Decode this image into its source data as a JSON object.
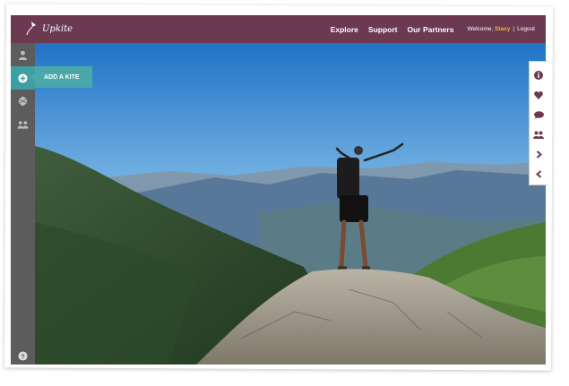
{
  "brand": {
    "logo_text": "Upkite"
  },
  "nav": {
    "links": [
      "Explore",
      "Support",
      "Our Partners"
    ],
    "welcome_prefix": "Welcome,",
    "username": "Stacy",
    "separator": "|",
    "logout": "Logout"
  },
  "sidebar": {
    "items": [
      {
        "icon": "user-icon"
      },
      {
        "icon": "plus-circle-icon",
        "active": true
      },
      {
        "icon": "kite-icon"
      },
      {
        "icon": "group-icon"
      }
    ],
    "help_icon": "help-icon"
  },
  "add_kite": {
    "label": "ADD A KITE"
  },
  "rightbar": {
    "icons": [
      "info-icon",
      "heart-icon",
      "comment-icon",
      "people-icon",
      "chevron-right-icon",
      "chevron-left-icon"
    ]
  },
  "colors": {
    "topbar": "#6b3950",
    "sidebar": "#5c5c5c",
    "accent": "#4aa7aa",
    "username": "#f2b534",
    "icons": "#6b3950"
  }
}
